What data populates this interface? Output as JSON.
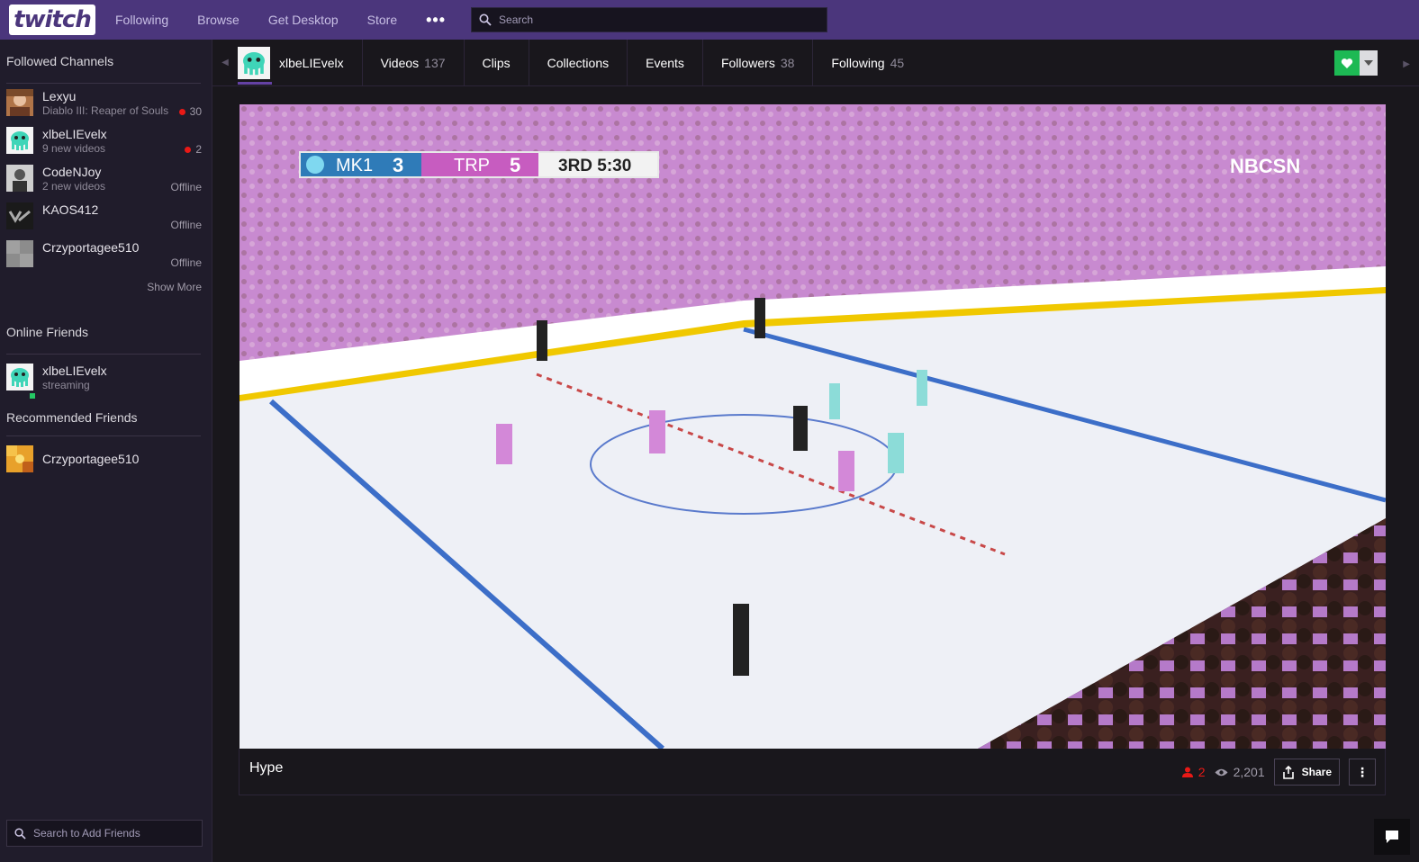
{
  "topnav": {
    "logo": "twitch",
    "links": [
      "Following",
      "Browse",
      "Get Desktop",
      "Store"
    ],
    "more": "•••",
    "search_placeholder": "Search"
  },
  "sidebar": {
    "followed_title": "Followed Channels",
    "channels": [
      {
        "name": "Lexyu",
        "sub": "Diablo III: Reaper of Souls",
        "status": "30",
        "live": true
      },
      {
        "name": "xlbeLIEvelx",
        "sub": "9 new videos",
        "status": "2",
        "live": true
      },
      {
        "name": "CodeNJoy",
        "sub": "2 new videos",
        "status": "Offline",
        "live": false
      },
      {
        "name": "KAOS412",
        "sub": "",
        "status": "Offline",
        "live": false
      },
      {
        "name": "Crzyportagee510",
        "sub": "",
        "status": "Offline",
        "live": false
      }
    ],
    "show_more": "Show More",
    "online_title": "Online Friends",
    "online_friend": {
      "name": "xlbeLIEvelx",
      "sub": "streaming"
    },
    "recommended_title": "Recommended Friends",
    "recommended_friend": {
      "name": "Crzyportagee510"
    },
    "friend_search_placeholder": "Search to Add Friends"
  },
  "channelbar": {
    "owner": "xlbeLIEvelx",
    "tabs": [
      {
        "label": "Videos",
        "count": "137"
      },
      {
        "label": "Clips",
        "count": ""
      },
      {
        "label": "Collections",
        "count": ""
      },
      {
        "label": "Events",
        "count": ""
      },
      {
        "label": "Followers",
        "count": "38"
      },
      {
        "label": "Following",
        "count": "45"
      }
    ]
  },
  "video": {
    "score": {
      "team1": "MK1",
      "score1": "3",
      "team2": "TRP",
      "score2": "5",
      "period": "3RD 5:30"
    },
    "network": "NBCSN"
  },
  "clip": {
    "title": "Hype",
    "viewers_live": "2",
    "views": "2,201",
    "share_label": "Share",
    "more": "⋮"
  },
  "colors": {
    "brand": "#4b367c",
    "live": "#e91916",
    "follow": "#1db954"
  }
}
